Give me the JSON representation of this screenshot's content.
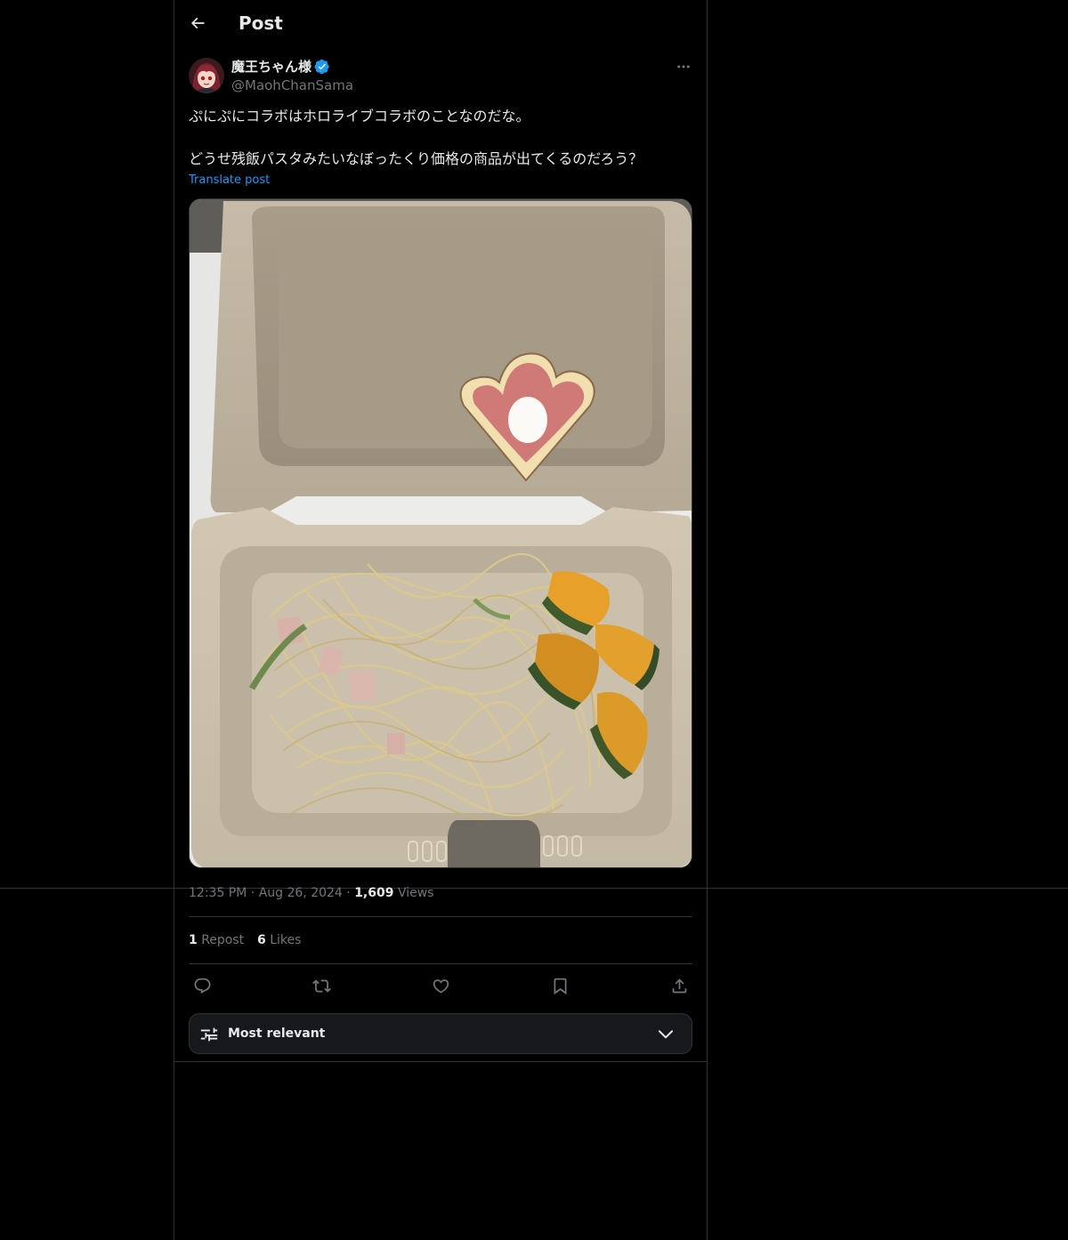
{
  "header": {
    "title": "Post"
  },
  "author": {
    "display_name": "魔王ちゃん様",
    "handle": "@MaohChanSama",
    "verified": true
  },
  "post": {
    "lines": [
      "ぷにぷにコラボはホロライブコラボのことなのだな。",
      "どうせ残飯パスタみたいなぼったくり価格の商品が出てくるのだろう？"
    ],
    "translate_label": "Translate post"
  },
  "meta": {
    "time": "12:35 PM",
    "date": "Aug 26, 2024",
    "views_count": "1,609",
    "views_label": "Views"
  },
  "stats": {
    "reposts_count": "1",
    "reposts_label": "Repost",
    "likes_count": "6",
    "likes_label": "Likes"
  },
  "actions": [
    "reply-icon",
    "repost-icon",
    "like-icon",
    "bookmark-icon",
    "share-icon"
  ],
  "sort": {
    "label": "Most relevant"
  },
  "colors": {
    "background": "#000000",
    "text": "#e7e9ea",
    "secondary": "#71767b",
    "accent": "#1d9bf0",
    "border": "#2f3336"
  }
}
